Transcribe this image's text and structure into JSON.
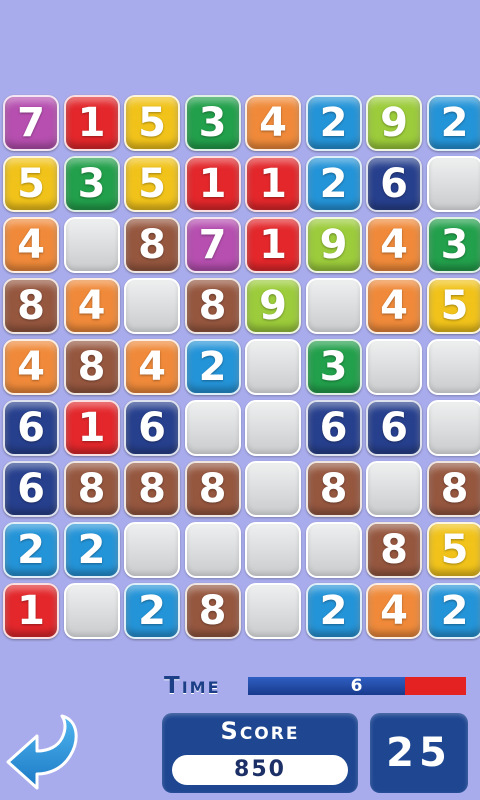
{
  "board": {
    "rows": [
      [
        {
          "n": "7",
          "c": "purple"
        },
        {
          "n": "1",
          "c": "red"
        },
        {
          "n": "5",
          "c": "yellow"
        },
        {
          "n": "3",
          "c": "green"
        },
        {
          "n": "4",
          "c": "orange"
        },
        {
          "n": "2",
          "c": "blue"
        },
        {
          "n": "9",
          "c": "lime"
        },
        {
          "n": "2",
          "c": "blue"
        }
      ],
      [
        {
          "n": "5",
          "c": "yellow"
        },
        {
          "n": "3",
          "c": "green"
        },
        {
          "n": "5",
          "c": "yellow"
        },
        {
          "n": "1",
          "c": "red"
        },
        {
          "n": "1",
          "c": "red"
        },
        {
          "n": "2",
          "c": "blue"
        },
        {
          "n": "6",
          "c": "navy"
        },
        {
          "n": "",
          "c": "empty"
        }
      ],
      [
        {
          "n": "4",
          "c": "orange"
        },
        {
          "n": "",
          "c": "empty"
        },
        {
          "n": "8",
          "c": "brown"
        },
        {
          "n": "7",
          "c": "purple"
        },
        {
          "n": "1",
          "c": "red"
        },
        {
          "n": "9",
          "c": "lime"
        },
        {
          "n": "4",
          "c": "orange"
        },
        {
          "n": "3",
          "c": "green"
        }
      ],
      [
        {
          "n": "8",
          "c": "brown"
        },
        {
          "n": "4",
          "c": "orange"
        },
        {
          "n": "",
          "c": "empty"
        },
        {
          "n": "8",
          "c": "brown"
        },
        {
          "n": "9",
          "c": "lime"
        },
        {
          "n": "",
          "c": "empty"
        },
        {
          "n": "4",
          "c": "orange"
        },
        {
          "n": "5",
          "c": "yellow"
        }
      ],
      [
        {
          "n": "4",
          "c": "orange"
        },
        {
          "n": "8",
          "c": "brown"
        },
        {
          "n": "4",
          "c": "orange"
        },
        {
          "n": "2",
          "c": "blue"
        },
        {
          "n": "",
          "c": "empty"
        },
        {
          "n": "3",
          "c": "green"
        },
        {
          "n": "",
          "c": "empty"
        },
        {
          "n": "",
          "c": "empty"
        }
      ],
      [
        {
          "n": "6",
          "c": "navy"
        },
        {
          "n": "1",
          "c": "red"
        },
        {
          "n": "6",
          "c": "navy"
        },
        {
          "n": "",
          "c": "empty"
        },
        {
          "n": "",
          "c": "empty"
        },
        {
          "n": "6",
          "c": "navy"
        },
        {
          "n": "6",
          "c": "navy"
        },
        {
          "n": "",
          "c": "empty"
        }
      ],
      [
        {
          "n": "6",
          "c": "navy"
        },
        {
          "n": "8",
          "c": "brown"
        },
        {
          "n": "8",
          "c": "brown"
        },
        {
          "n": "8",
          "c": "brown"
        },
        {
          "n": "",
          "c": "empty"
        },
        {
          "n": "8",
          "c": "brown"
        },
        {
          "n": "",
          "c": "empty"
        },
        {
          "n": "8",
          "c": "brown"
        }
      ],
      [
        {
          "n": "2",
          "c": "blue"
        },
        {
          "n": "2",
          "c": "blue"
        },
        {
          "n": "",
          "c": "empty"
        },
        {
          "n": "",
          "c": "empty"
        },
        {
          "n": "",
          "c": "empty"
        },
        {
          "n": "",
          "c": "empty"
        },
        {
          "n": "8",
          "c": "brown"
        },
        {
          "n": "5",
          "c": "yellow"
        }
      ],
      [
        {
          "n": "1",
          "c": "red"
        },
        {
          "n": "",
          "c": "empty"
        },
        {
          "n": "2",
          "c": "blue"
        },
        {
          "n": "8",
          "c": "brown"
        },
        {
          "n": "",
          "c": "empty"
        },
        {
          "n": "2",
          "c": "blue"
        },
        {
          "n": "4",
          "c": "orange"
        },
        {
          "n": "2",
          "c": "blue"
        }
      ]
    ]
  },
  "colors": {
    "purple": "#b64fb0",
    "red": "#e3272b",
    "yellow": "#f1c31a",
    "green": "#22a04b",
    "orange": "#f08a3a",
    "blue": "#2494d8",
    "lime": "#9ccc3b",
    "navy": "#27408e",
    "brown": "#96573f",
    "background": "#a9acec",
    "panel": "#1f4791",
    "time_remaining": "#1f4791",
    "time_elapsed": "#e52222"
  },
  "hud": {
    "time_label": "Time",
    "time_value": "6",
    "time_fraction": 0.72,
    "score_label": "Score",
    "score_value": "850",
    "level_value": "25"
  },
  "icons": {
    "back": "curved-back-arrow-icon"
  }
}
